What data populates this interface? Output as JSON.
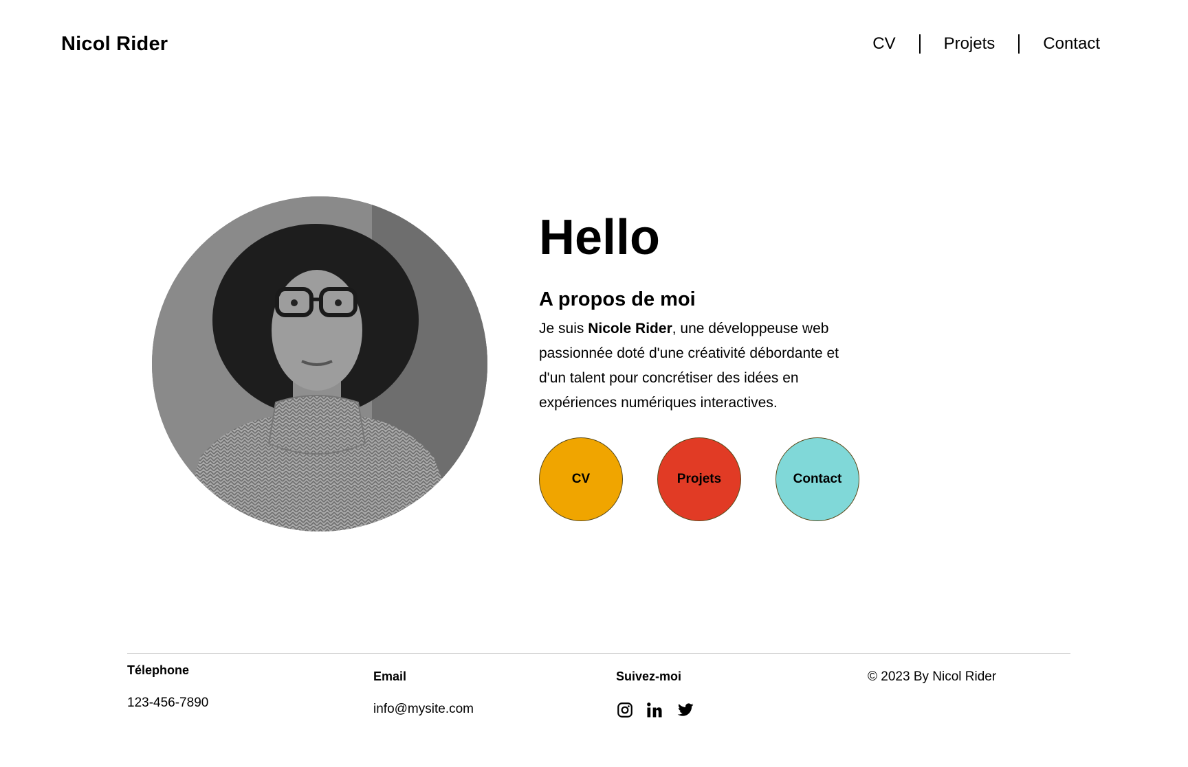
{
  "header": {
    "site_title": "Nicol Rider",
    "nav": [
      "CV",
      "Projets",
      "Contact"
    ]
  },
  "hero": {
    "hello": "Hello",
    "about_title": "A propos de moi",
    "about_intro": "Je suis ",
    "about_name": "Nicole Rider",
    "about_rest": ", une développeuse web passionnée doté d'une créativité débordante et d'un talent pour concrétiser des idées en expériences numériques interactives.",
    "buttons": [
      {
        "label": "CV",
        "color": "#F0A500"
      },
      {
        "label": "Projets",
        "color": "#E13B25"
      },
      {
        "label": "Contact",
        "color": "#80D8D8"
      }
    ]
  },
  "footer": {
    "phone_label": "Télephone",
    "phone": "123-456-7890",
    "email_label": "Email",
    "email": "info@mysite.com",
    "social_label": "Suivez-moi",
    "social_icons": [
      "instagram-icon",
      "linkedin-icon",
      "twitter-icon"
    ],
    "copyright": "© 2023 By Nicol Rider"
  }
}
